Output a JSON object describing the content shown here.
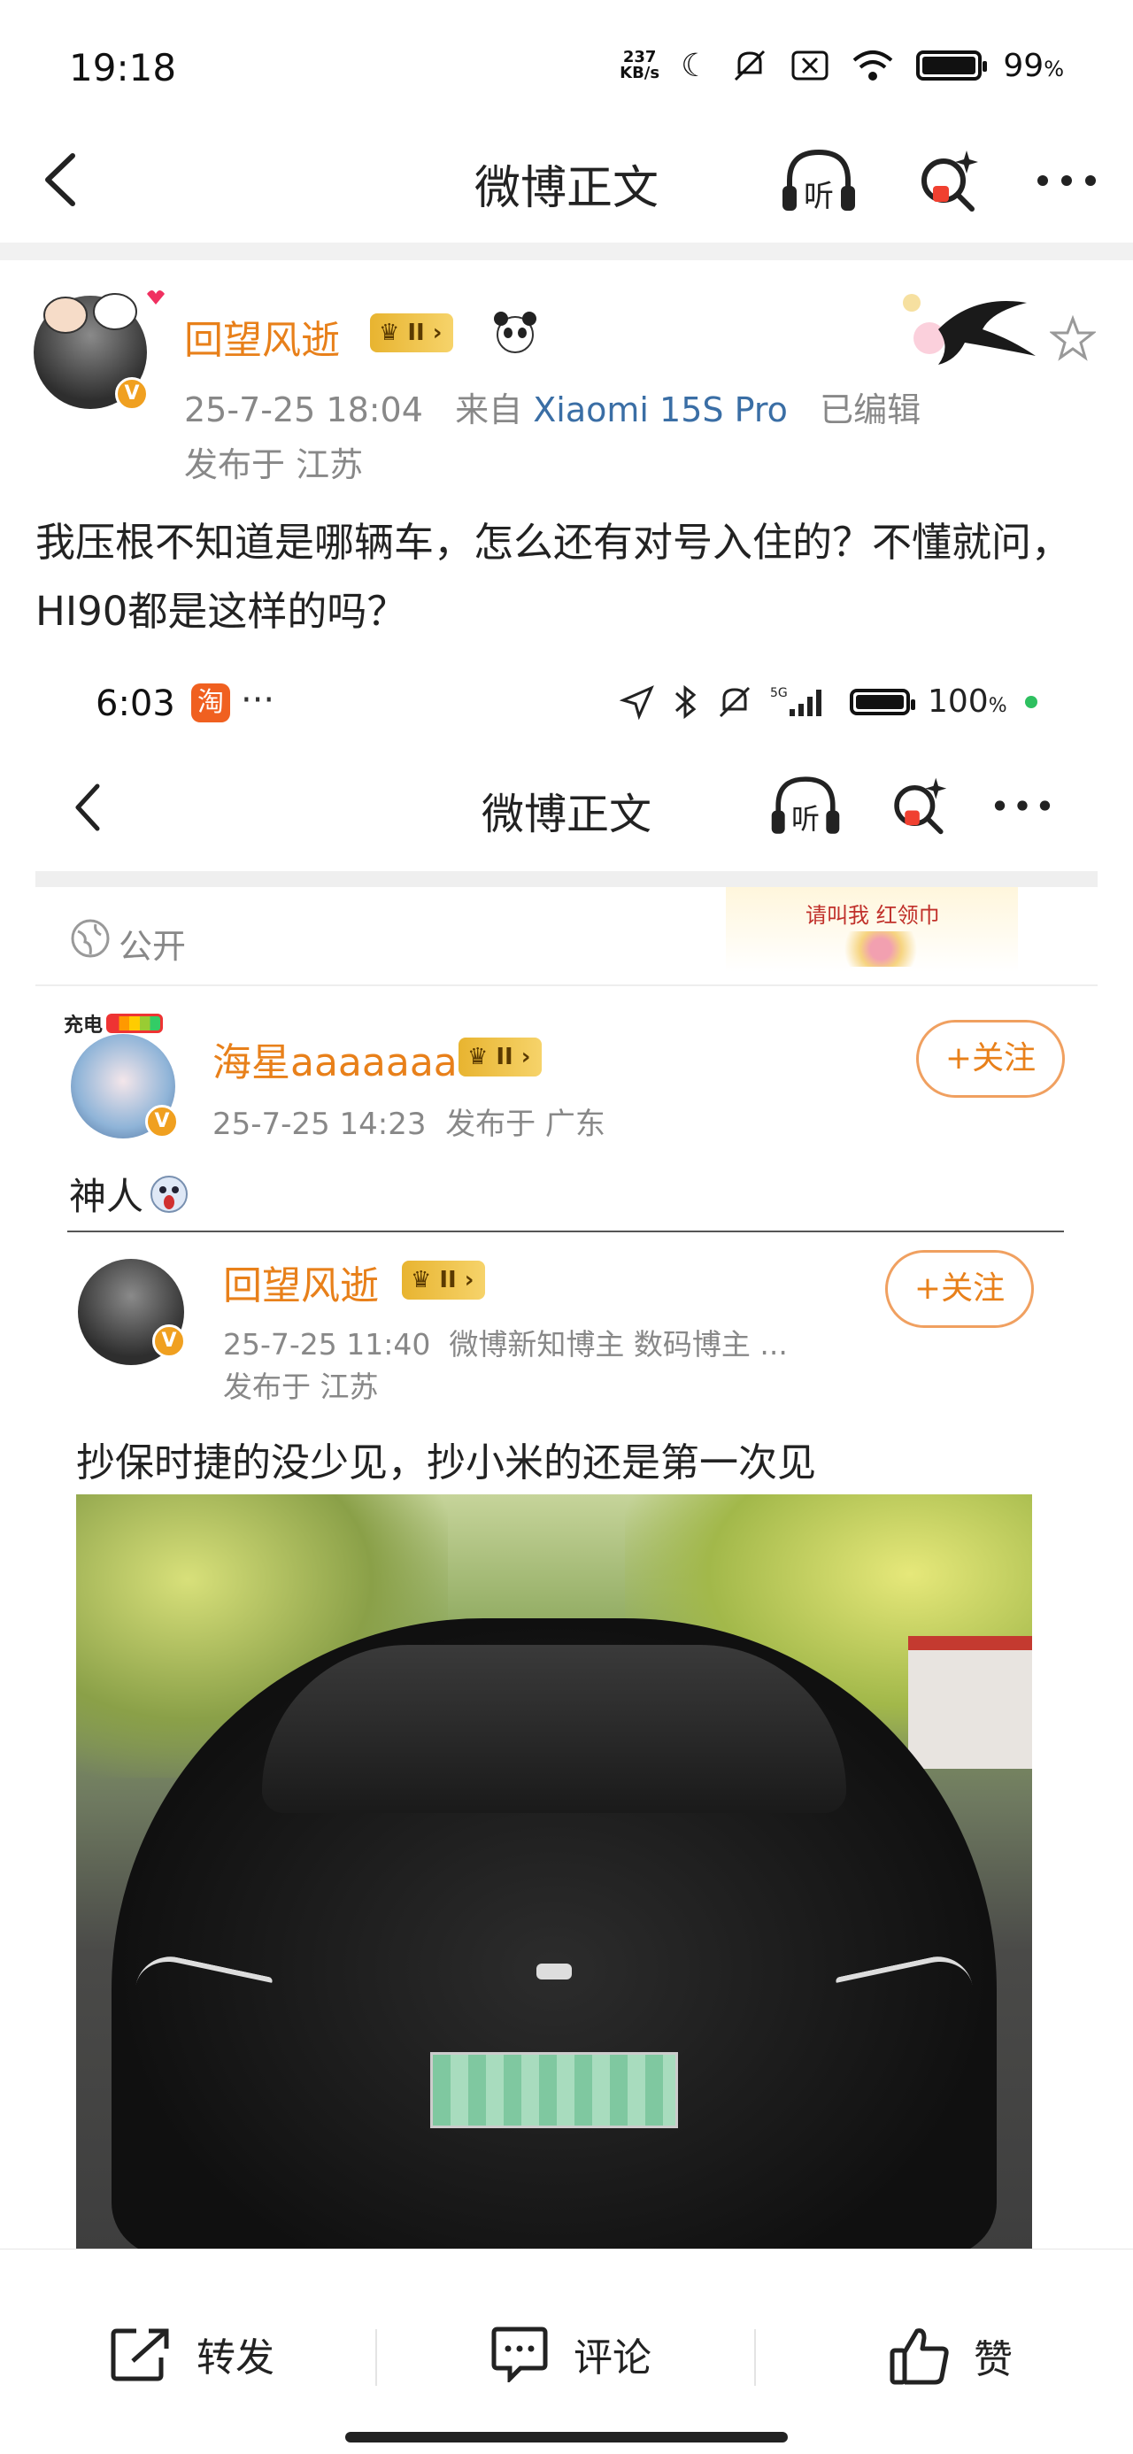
{
  "status_bar": {
    "time": "19:18",
    "net_speed_value": "237",
    "net_speed_unit": "KB/s",
    "battery": "99",
    "battery_unit": "%"
  },
  "nav": {
    "title": "微博正文",
    "listen_label": "听"
  },
  "post": {
    "author": "回望风逝",
    "level_badge": "II",
    "date": "25-7-25 18:04",
    "source_prefix": "来自",
    "source_device": "Xiaomi 15S Pro",
    "edited": "已编辑",
    "location": "发布于 江苏",
    "text": "我压根不知道是哪辆车，怎么还有对号入住的？不懂就问，HI90都是这样的吗？"
  },
  "embedded": {
    "status_time": "6:03",
    "status_dots": "···",
    "battery": "100",
    "battery_unit": "%",
    "nav_title": "微博正文",
    "listen_label": "听",
    "visibility": "公开",
    "banner_text": "请叫我 红领巾",
    "charge_label": "充电",
    "repost": {
      "author": "海星aaaaaaa",
      "level_badge": "II",
      "date": "25-7-25 14:23",
      "location": "发布于 广东",
      "follow_label": "+关注",
      "text": "神人"
    },
    "original": {
      "author": "回望风逝",
      "level_badge": "II",
      "date": "25-7-25 11:40",
      "tags": "微博新知博主 数码博主 ...",
      "location": "发布于 江苏",
      "follow_label": "+关注",
      "text": "抄保时捷的没少见，抄小米的还是第一次见"
    }
  },
  "actions": {
    "repost": "转发",
    "comment": "评论",
    "like": "赞"
  },
  "colors": {
    "username": "#e8801a",
    "link": "#3a6ea5",
    "meta": "#888888"
  }
}
